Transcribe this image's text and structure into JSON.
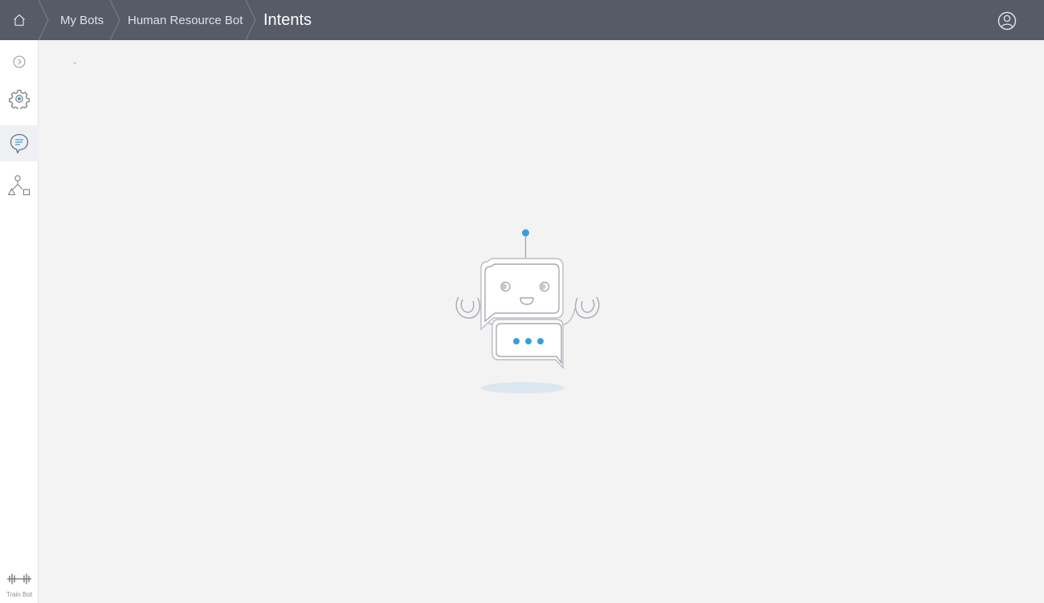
{
  "header": {
    "breadcrumbs": [
      {
        "label": "My Bots"
      },
      {
        "label": "Human Resource Bot"
      }
    ],
    "current_page": "Intents",
    "icons": {
      "home": "home-icon",
      "user": "user-account-icon"
    }
  },
  "sidebar": {
    "items": [
      {
        "name": "expand-sidebar",
        "icon": "chevron-right-circle-icon"
      },
      {
        "name": "settings",
        "icon": "gear-icon"
      },
      {
        "name": "intents",
        "icon": "chat-bubble-icon",
        "active": true
      },
      {
        "name": "flow",
        "icon": "shapes-hierarchy-icon"
      }
    ],
    "train_bot_label": "Train Bot"
  },
  "main": {
    "placeholder_text": "-"
  },
  "colors": {
    "header_bg": "#575b67",
    "accent": "#3a9fd8",
    "page_bg": "#f3f3f4"
  }
}
